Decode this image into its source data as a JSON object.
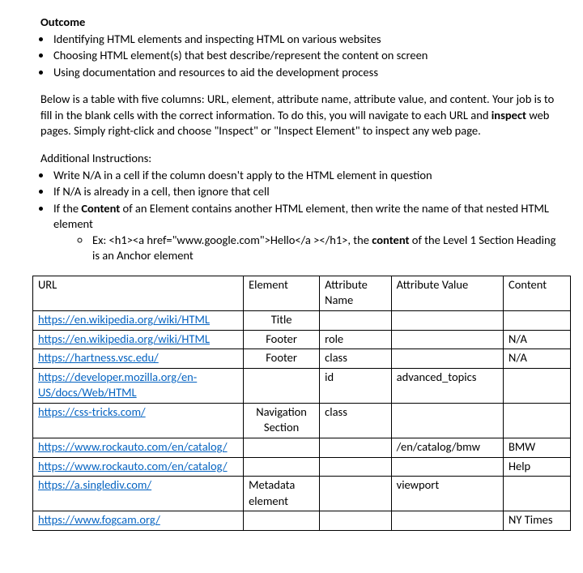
{
  "outcome": {
    "heading": "Outcome",
    "items": [
      "Identifying HTML elements and inspecting HTML on various websites",
      "Choosing HTML element(s) that best describe/represent the content on screen",
      "Using documentation and resources to aid the development process"
    ]
  },
  "intro": {
    "p1_a": "Below is a table with five columns: URL, element, attribute name, attribute value, and content.  Your job is to fill in the blank cells with the correct information.  To do this, you will navigate to each URL and ",
    "p1_bold": "inspect",
    "p1_b": " web pages.  Simply right-click and choose \"Inspect\" or \"Inspect Element\" to inspect any web page."
  },
  "additional": {
    "heading": "Additional Instructions:",
    "items": [
      "Write N/A in a cell if the column doesn't apply to the HTML element in question",
      "If N/A is already in a cell, then ignore that cell"
    ],
    "item3_a": "If the ",
    "item3_bold": "Content",
    "item3_b": " of an Element contains another HTML element, then write the name of that nested HTML element",
    "ex_a": "Ex: <h1><a href=\"www.google.com\">Hello</a ></h1>, the ",
    "ex_bold": "content",
    "ex_b": " of the Level 1 Section Heading is an Anchor element"
  },
  "table": {
    "headers": {
      "url": "URL",
      "element": "Element",
      "attr_name": "Attribute Name",
      "attr_value": "Attribute Value",
      "content": "Content"
    },
    "rows": [
      {
        "url": "https://en.wikipedia.org/wiki/HTML",
        "element": "Title",
        "attr_name": "",
        "attr_value": "",
        "content": ""
      },
      {
        "url": "https://en.wikipedia.org/wiki/HTML",
        "element": "Footer",
        "attr_name": "role",
        "attr_value": "",
        "content": "N/A"
      },
      {
        "url": "https://hartness.vsc.edu/",
        "element": "Footer",
        "attr_name": "class",
        "attr_value": "",
        "content": "N/A"
      },
      {
        "url": "https://developer.mozilla.org/en-US/docs/Web/HTML",
        "element": "",
        "attr_name": "id",
        "attr_value": "advanced_topics",
        "content": ""
      },
      {
        "url": "https://css-tricks.com/",
        "element": "Navigation Section",
        "attr_name": "class",
        "attr_value": "",
        "content": ""
      },
      {
        "url": "https://www.rockauto.com/en/catalog/",
        "element": "",
        "attr_name": "",
        "attr_value": "/en/catalog/bmw",
        "content": "BMW"
      },
      {
        "url": "https://www.rockauto.com/en/catalog/",
        "element": "",
        "attr_name": "",
        "attr_value": "",
        "content": "Help"
      },
      {
        "url": "https://a.singlediv.com/",
        "element": "Metadata element",
        "attr_name": "",
        "attr_value": "viewport",
        "content": ""
      },
      {
        "url": "https://www.fogcam.org/",
        "element": "",
        "attr_name": "",
        "attr_value": "",
        "content": "NY Times"
      }
    ]
  },
  "chart_data": {
    "type": "table",
    "columns": [
      "URL",
      "Element",
      "Attribute Name",
      "Attribute Value",
      "Content"
    ],
    "rows": [
      [
        "https://en.wikipedia.org/wiki/HTML",
        "Title",
        "",
        "",
        ""
      ],
      [
        "https://en.wikipedia.org/wiki/HTML",
        "Footer",
        "role",
        "",
        "N/A"
      ],
      [
        "https://hartness.vsc.edu/",
        "Footer",
        "class",
        "",
        "N/A"
      ],
      [
        "https://developer.mozilla.org/en-US/docs/Web/HTML",
        "",
        "id",
        "advanced_topics",
        ""
      ],
      [
        "https://css-tricks.com/",
        "Navigation Section",
        "class",
        "",
        ""
      ],
      [
        "https://www.rockauto.com/en/catalog/",
        "",
        "",
        "/en/catalog/bmw",
        "BMW"
      ],
      [
        "https://www.rockauto.com/en/catalog/",
        "",
        "",
        "",
        "Help"
      ],
      [
        "https://a.singlediv.com/",
        "Metadata element",
        "",
        "viewport",
        ""
      ],
      [
        "https://www.fogcam.org/",
        "",
        "",
        "",
        "NY Times"
      ]
    ]
  }
}
